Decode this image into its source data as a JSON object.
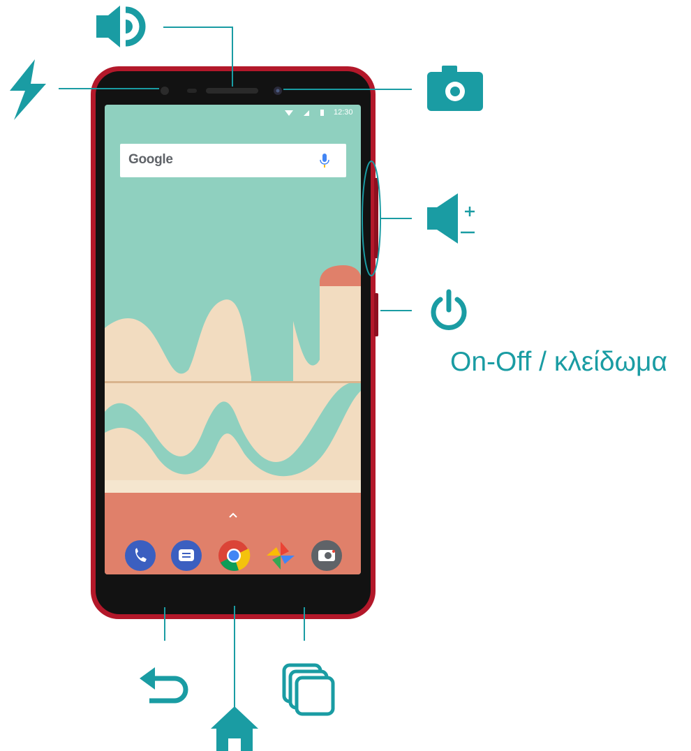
{
  "callouts": {
    "power": {
      "label": "On-Off / κλείδωμα",
      "icon": "power-icon"
    },
    "volume": {
      "icon": "volume-plus-minus-icon"
    },
    "earpiece": {
      "icon": "speaker-icon"
    },
    "flash": {
      "icon": "flash-icon"
    },
    "front_camera": {
      "icon": "camera-icon"
    },
    "back": {
      "icon": "back-arrow-icon"
    },
    "home": {
      "icon": "home-icon"
    },
    "recents": {
      "icon": "recents-icon"
    }
  },
  "phone_screen": {
    "status_bar": {
      "time": "12:30"
    },
    "search_bar": {
      "text": "Google"
    },
    "dock_apps": [
      "phone-app-icon",
      "messages-app-icon",
      "chrome-app-icon",
      "photos-app-icon",
      "camera-app-icon"
    ]
  },
  "colors": {
    "accent": "#1a9ca3",
    "phone_body": "#b3182a",
    "wallpaper_mint": "#8fd0bf",
    "wallpaper_cream": "#f2dcc0",
    "wallpaper_coral": "#e0806a"
  }
}
